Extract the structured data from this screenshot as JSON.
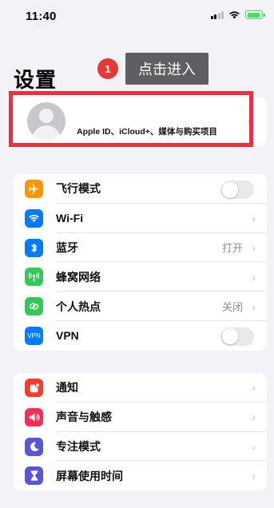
{
  "status_bar": {
    "time": "11:40"
  },
  "header": {
    "title": "设置"
  },
  "callout": {
    "step": "1",
    "text": "点击进入"
  },
  "apple_id": {
    "label": "Apple ID、iCloud+、媒体与购买项目"
  },
  "group1": [
    {
      "label": "飞行模式",
      "icon": "airplane-icon",
      "color": "#ff9500"
    },
    {
      "label": "Wi-Fi",
      "icon": "wifi-icon",
      "color": "#007aff"
    },
    {
      "label": "蓝牙",
      "icon": "bluetooth-icon",
      "color": "#007aff",
      "value": "打开"
    },
    {
      "label": "蜂窝网络",
      "icon": "cellular-icon",
      "color": "#34c759"
    },
    {
      "label": "个人热点",
      "icon": "hotspot-icon",
      "color": "#34c759",
      "value": "关闭"
    },
    {
      "label": "VPN",
      "icon": "vpn-icon",
      "color": "#007aff",
      "icon_text": "VPN"
    }
  ],
  "group2": [
    {
      "label": "通知",
      "icon": "notification-icon",
      "color": "#ff3b30"
    },
    {
      "label": "声音与触感",
      "icon": "sound-icon",
      "color": "#ff2d55"
    },
    {
      "label": "专注模式",
      "icon": "focus-moon-icon",
      "color": "#5856d6"
    },
    {
      "label": "屏幕使用时间",
      "icon": "hourglass-icon",
      "color": "#5856d6"
    }
  ]
}
